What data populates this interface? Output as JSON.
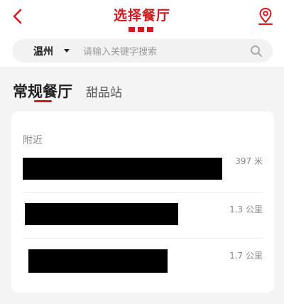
{
  "header": {
    "title": "选择餐厅",
    "back_icon": "chevron-left-icon",
    "map_icon": "map-pin-icon",
    "brand_color": "#d5181f"
  },
  "search": {
    "city": "温州",
    "placeholder": "请输入关键字搜索",
    "icon": "search-icon"
  },
  "tabs": [
    {
      "label": "常规餐厅",
      "active": true
    },
    {
      "label": "甜品站",
      "active": false
    }
  ],
  "list": {
    "section_label": "附近",
    "items": [
      {
        "name": "",
        "address": "",
        "distance": "397 米",
        "redacted": true
      },
      {
        "name": "",
        "address": "",
        "distance": "1.3 公里",
        "redacted": true
      },
      {
        "name": "",
        "address": "",
        "distance": "1.7 公里",
        "redacted": true
      }
    ]
  }
}
